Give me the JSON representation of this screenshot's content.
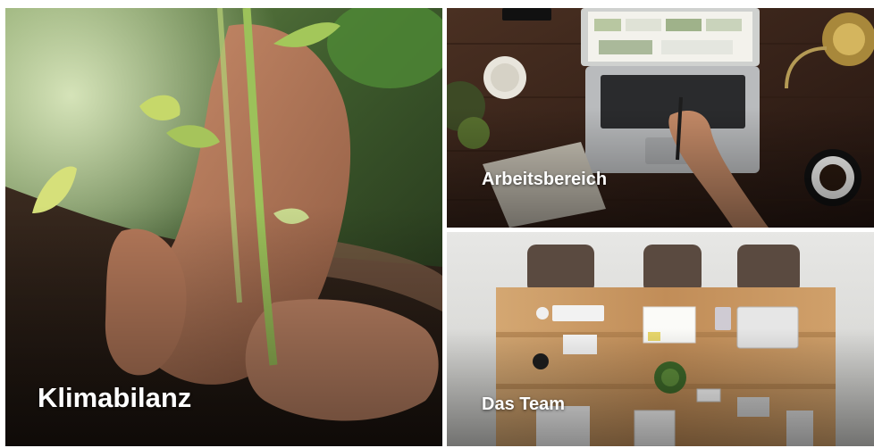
{
  "tiles": [
    {
      "title": "Klimabilanz",
      "image": "seedling-planting-photo"
    },
    {
      "title": "Arbeitsbereich",
      "image": "laptop-desk-photo"
    },
    {
      "title": "Das Team",
      "image": "team-table-photo"
    }
  ],
  "colors": {
    "label_text": "#ffffff",
    "soil": "#2a1e16",
    "desk_wood": "#3a2518",
    "table_wood": "#c99a63",
    "wall": "#d8d8d6"
  }
}
